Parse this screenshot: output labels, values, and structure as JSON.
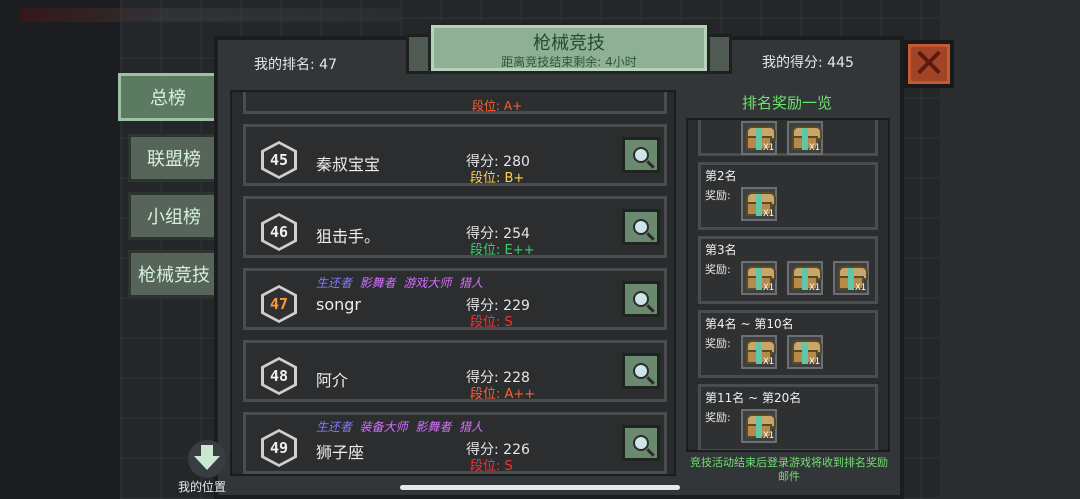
{
  "header": {
    "title": "枪械竞技",
    "subtitle": "距离竞技结束剩余: 4小时",
    "my_rank": "我的排名: 47",
    "my_score": "我的得分: 445"
  },
  "tabs": [
    {
      "label": "总榜",
      "active": true
    },
    {
      "label": "联盟榜",
      "active": false
    },
    {
      "label": "小组榜",
      "active": false
    },
    {
      "label": "枪械竞技",
      "active": false
    }
  ],
  "leaderboard": {
    "partial_top_tier": "段位: A+",
    "rows": [
      {
        "rank": "45",
        "name": "秦叔宝宝",
        "tags": [],
        "score": "得分: 280",
        "tier": "段位: B+",
        "tier_color": "#ffd34a",
        "me": false
      },
      {
        "rank": "46",
        "name": "狙击手。",
        "tags": [],
        "score": "得分: 254",
        "tier": "段位: E++",
        "tier_color": "#3ad06a",
        "me": false
      },
      {
        "rank": "47",
        "name": "songr",
        "tags": [
          {
            "t": "生还者",
            "c": "a"
          },
          {
            "t": "影舞者",
            "c": "b"
          },
          {
            "t": "游戏大师",
            "c": "b"
          },
          {
            "t": "猎人",
            "c": "b"
          }
        ],
        "score": "得分: 229",
        "tier": "段位: S",
        "tier_color": "#ff3030",
        "me": true
      },
      {
        "rank": "48",
        "name": "阿介",
        "tags": [],
        "score": "得分: 228",
        "tier": "段位: A++",
        "tier_color": "#ff6030",
        "me": false
      },
      {
        "rank": "49",
        "name": "狮子座",
        "tags": [
          {
            "t": "生还者",
            "c": "a"
          },
          {
            "t": "装备大师",
            "c": "b"
          },
          {
            "t": "影舞者",
            "c": "b"
          },
          {
            "t": "猎人",
            "c": "b"
          }
        ],
        "score": "得分: 226",
        "tier": "段位: S",
        "tier_color": "#ff3030",
        "me": false
      }
    ]
  },
  "rewards": {
    "title": "排名奖励一览",
    "cards": [
      {
        "rank": "",
        "label": "",
        "count": 2
      },
      {
        "rank": "第2名",
        "label": "奖励:",
        "count": 1
      },
      {
        "rank": "第3名",
        "label": "奖励:",
        "count": 3
      },
      {
        "rank": "第4名 ~ 第10名",
        "label": "奖励:",
        "count": 2
      },
      {
        "rank": "第11名 ~ 第20名",
        "label": "奖励:",
        "count": 1
      }
    ],
    "chest_count_label": "X1",
    "footer": "竞技活动结束后登录游戏将收到排名奖励邮件"
  },
  "my_position_label": "我的位置"
}
